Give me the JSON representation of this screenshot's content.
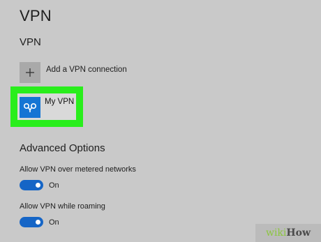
{
  "page": {
    "title": "VPN",
    "section_title": "VPN"
  },
  "add_connection": {
    "label": "Add a VPN connection",
    "icon": "plus-icon"
  },
  "vpn_item": {
    "name": "My VPN",
    "icon": "vpn-link-icon",
    "highlight_color": "#29ee1c",
    "icon_color": "#1575d4"
  },
  "advanced": {
    "title": "Advanced Options",
    "options": [
      {
        "label": "Allow VPN over metered networks",
        "state": "On",
        "enabled": true
      },
      {
        "label": "Allow VPN while roaming",
        "state": "On",
        "enabled": true
      }
    ]
  },
  "colors": {
    "background": "#c9c9c9",
    "toggle_on": "#1565c6"
  },
  "watermark": {
    "part1": "wiki",
    "part2": "How"
  }
}
